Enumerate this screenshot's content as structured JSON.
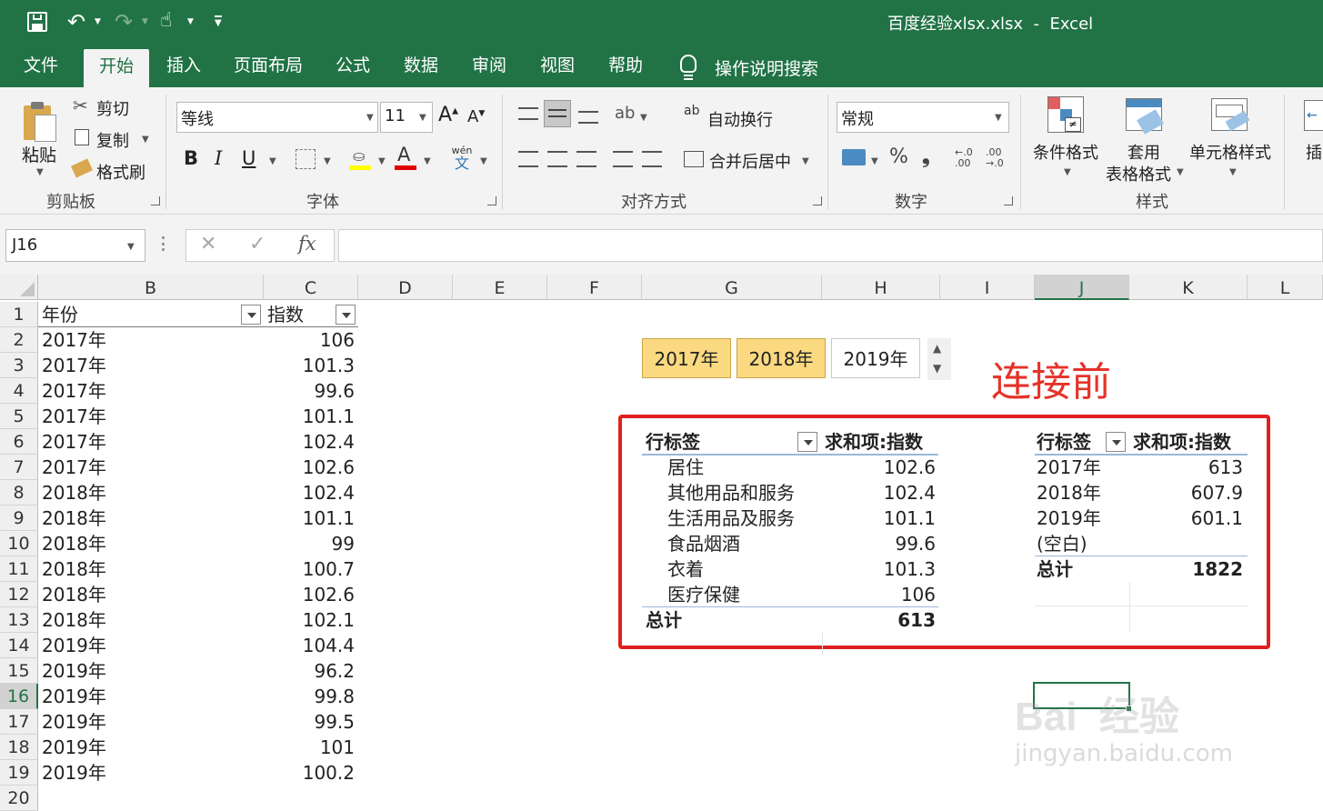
{
  "window": {
    "title": "百度经验xlsx.xlsx  -  Excel"
  },
  "tabs": [
    "文件",
    "开始",
    "插入",
    "页面布局",
    "公式",
    "数据",
    "审阅",
    "视图",
    "帮助"
  ],
  "active_tab": "开始",
  "tell_me": "操作说明搜索",
  "ribbon": {
    "clipboard": {
      "paste": "粘贴",
      "cut": "剪切",
      "copy": "复制",
      "format_painter": "格式刷",
      "label": "剪贴板"
    },
    "font": {
      "name": "等线",
      "size": "11",
      "bold": "B",
      "italic": "I",
      "underline": "U",
      "label": "字体",
      "phonetic_top": "wén",
      "phonetic_bottom": "文"
    },
    "alignment": {
      "wrap": "自动换行",
      "merge": "合并后居中",
      "label": "对齐方式"
    },
    "number": {
      "format": "常规",
      "percent": "%",
      "comma": "❟",
      "inc_top": "←.0",
      "inc_bottom": ".00",
      "dec_top": ".00",
      "dec_bottom": "→.0",
      "label": "数字"
    },
    "styles": {
      "conditional": "条件格式",
      "table_top": "套用",
      "table_bottom": "表格格式",
      "cell_styles": "单元格样式",
      "insert": "插",
      "label": "样式"
    }
  },
  "formula_bar": {
    "name_box": "J16",
    "fx": "fx",
    "cancel": "✕",
    "confirm": "✓",
    "value": ""
  },
  "columns": [
    "B",
    "C",
    "D",
    "E",
    "F",
    "G",
    "H",
    "I",
    "J",
    "K",
    "L"
  ],
  "rows": [
    "1",
    "2",
    "3",
    "4",
    "5",
    "6",
    "7",
    "8",
    "9",
    "10",
    "11",
    "12",
    "13",
    "14",
    "15",
    "16",
    "17",
    "18",
    "19",
    "20"
  ],
  "table": {
    "header": {
      "year": "年份",
      "index": "指数"
    },
    "data": [
      [
        "2017年",
        "106"
      ],
      [
        "2017年",
        "101.3"
      ],
      [
        "2017年",
        "99.6"
      ],
      [
        "2017年",
        "101.1"
      ],
      [
        "2017年",
        "102.4"
      ],
      [
        "2017年",
        "102.6"
      ],
      [
        "2018年",
        "102.4"
      ],
      [
        "2018年",
        "101.1"
      ],
      [
        "2018年",
        "99"
      ],
      [
        "2018年",
        "100.7"
      ],
      [
        "2018年",
        "102.6"
      ],
      [
        "2018年",
        "102.1"
      ],
      [
        "2019年",
        "104.4"
      ],
      [
        "2019年",
        "96.2"
      ],
      [
        "2019年",
        "99.8"
      ],
      [
        "2019年",
        "99.5"
      ],
      [
        "2019年",
        "101"
      ],
      [
        "2019年",
        "100.2"
      ]
    ]
  },
  "slicer": {
    "items": [
      "2017年",
      "2018年",
      "2019年"
    ],
    "selected": [
      "2017年",
      "2018年"
    ]
  },
  "annotation": "连接前",
  "annotation_color": "#e5332a",
  "pivot1": {
    "header_label": "行标签",
    "header_value": "求和项:指数",
    "rows": [
      [
        "居住",
        "102.6"
      ],
      [
        "其他用品和服务",
        "102.4"
      ],
      [
        "生活用品及服务",
        "101.1"
      ],
      [
        "食品烟酒",
        "99.6"
      ],
      [
        "衣着",
        "101.3"
      ],
      [
        "医疗保健",
        "106"
      ]
    ],
    "total_label": "总计",
    "total_value": "613"
  },
  "pivot2": {
    "header_label": "行标签",
    "header_value": "求和项:指数",
    "rows": [
      [
        "2017年",
        "613"
      ],
      [
        "2018年",
        "607.9"
      ],
      [
        "2019年",
        "601.1"
      ],
      [
        "(空白)",
        ""
      ]
    ],
    "total_label": "总计",
    "total_value": "1822"
  },
  "watermark": {
    "brand": "Bai  经验",
    "url": "jingyan.baidu.com"
  },
  "colors": {
    "excel_green": "#217346",
    "slicer_selected": "#fbd980",
    "highlight_border": "#e02020"
  }
}
